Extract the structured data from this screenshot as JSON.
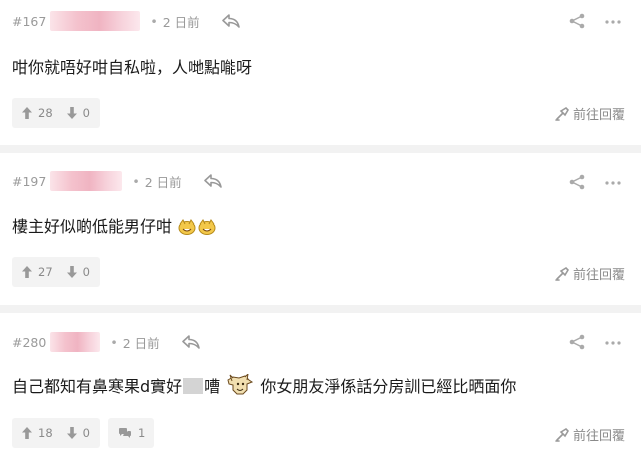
{
  "posts": [
    {
      "floor": "#167",
      "time": "2 日前",
      "content": "咁你就唔好咁自私啦，人哋點𠹌呀",
      "upvotes": "28",
      "downvotes": "0",
      "goto_label": "前往回覆"
    },
    {
      "floor": "#197",
      "time": "2 日前",
      "content": "樓主好似啲低能男仔咁",
      "upvotes": "27",
      "downvotes": "0",
      "goto_label": "前往回覆"
    },
    {
      "floor": "#280",
      "time": "2 日前",
      "content_a": "自己都知有鼻寒果d實好",
      "content_b": "嘈",
      "content_c": " 你女朋友淨係話分房訓已經比晒面你",
      "upvotes": "18",
      "downvotes": "0",
      "comments": "1",
      "goto_label": "前往回覆"
    }
  ],
  "icons": {
    "reply": "reply-icon",
    "share": "share-icon",
    "more": "more-icon",
    "upvote": "upvote-icon",
    "downvote": "downvote-icon",
    "comment": "comment-icon",
    "goto": "goto-reply-icon"
  },
  "colors": {
    "meta_text": "#999999",
    "blur_name": "#f0b4c2",
    "divider": "#f2f2f2",
    "vote_bg": "#f3f3f3"
  }
}
